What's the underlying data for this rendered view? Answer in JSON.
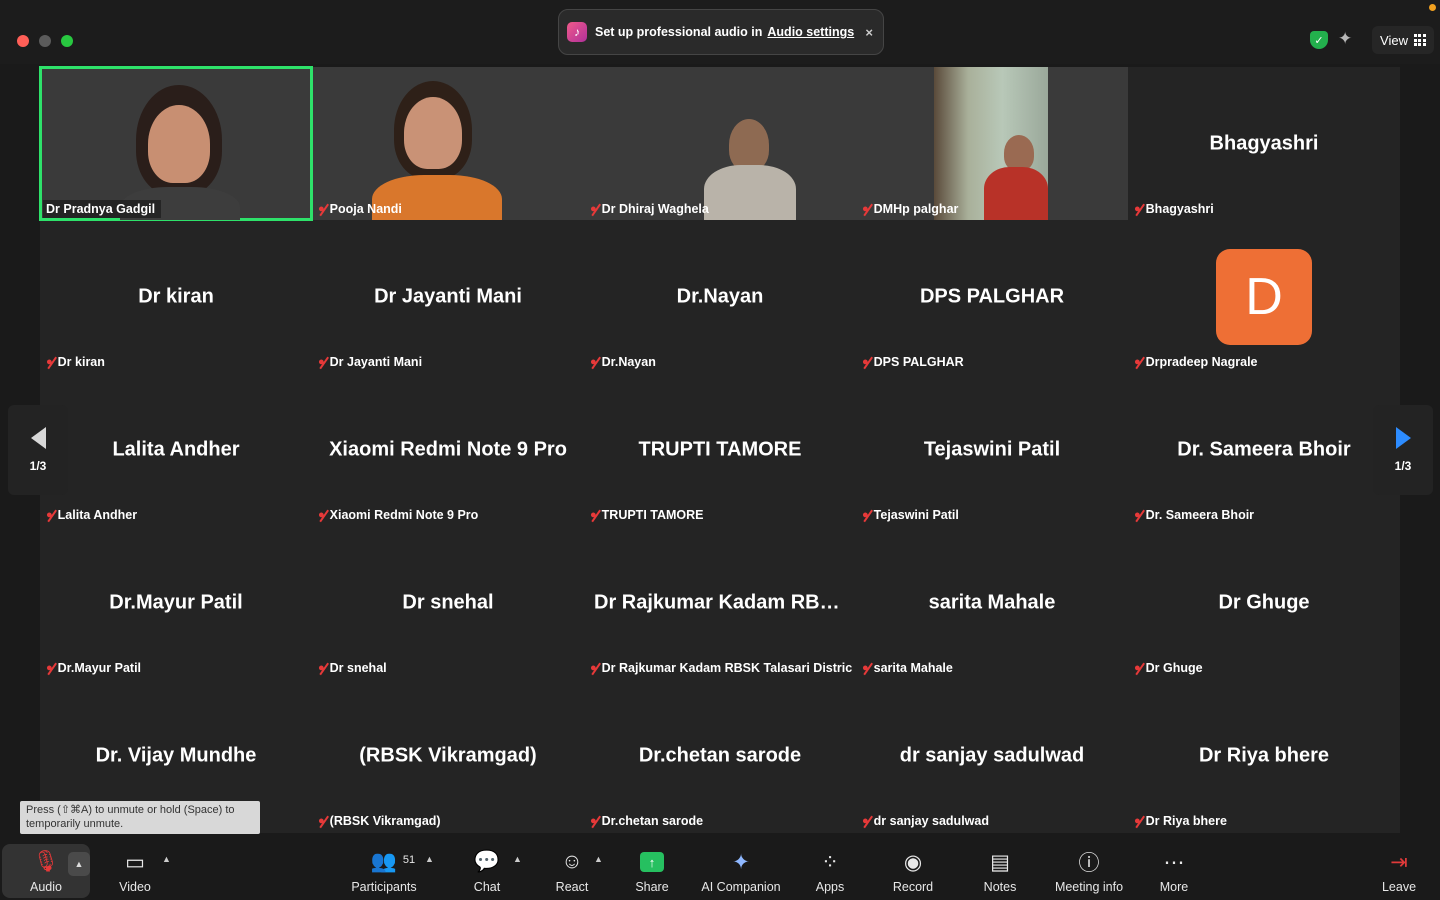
{
  "banner": {
    "text": "Set up professional audio in",
    "link": "Audio settings",
    "close": "×"
  },
  "topbar": {
    "view_label": "View"
  },
  "tiles": [
    {
      "label": "Dr Pradnya Gadgil",
      "center": ""
    },
    {
      "label": "Pooja Nandi",
      "center": ""
    },
    {
      "label": "Dr Dhiraj Waghela",
      "center": ""
    },
    {
      "label": "DMHp palghar",
      "center": ""
    },
    {
      "label": "Bhagyashri",
      "center": "Bhagyashri"
    },
    {
      "label": "Dr kiran",
      "center": "Dr kiran"
    },
    {
      "label": "Dr Jayanti Mani",
      "center": "Dr Jayanti Mani"
    },
    {
      "label": "Dr.Nayan",
      "center": "Dr.Nayan"
    },
    {
      "label": "DPS PALGHAR",
      "center": "DPS PALGHAR"
    },
    {
      "label": "Drpradeep Nagrale",
      "center": "",
      "avatar": "D"
    },
    {
      "label": "Lalita Andher",
      "center": "Lalita Andher"
    },
    {
      "label": "Xiaomi Redmi Note 9 Pro",
      "center": "Xiaomi Redmi Note 9 Pro"
    },
    {
      "label": "TRUPTI TAMORE",
      "center": "TRUPTI TAMORE"
    },
    {
      "label": "Tejaswini Patil",
      "center": "Tejaswini Patil"
    },
    {
      "label": "Dr. Sameera Bhoir",
      "center": "Dr. Sameera Bhoir"
    },
    {
      "label": "Dr.Mayur Patil",
      "center": "Dr.Mayur Patil"
    },
    {
      "label": "Dr snehal",
      "center": "Dr snehal"
    },
    {
      "label": "Dr Rajkumar Kadam RBSK Talasari Distric...",
      "center": "Dr Rajkumar Kadam RBSK..."
    },
    {
      "label": "sarita Mahale",
      "center": "sarita Mahale"
    },
    {
      "label": "Dr Ghuge",
      "center": "Dr Ghuge"
    },
    {
      "label": "",
      "center": "Dr. Vijay Mundhe"
    },
    {
      "label": "(RBSK Vikramgad)",
      "center": "(RBSK Vikramgad)"
    },
    {
      "label": "Dr.chetan sarode",
      "center": "Dr.chetan sarode"
    },
    {
      "label": "dr sanjay sadulwad",
      "center": "dr sanjay sadulwad"
    },
    {
      "label": "Dr Riya bhere",
      "center": "Dr Riya bhere"
    }
  ],
  "pagination": {
    "left": "1/3",
    "right": "1/3"
  },
  "tooltip": "Press (⇧⌘A) to unmute or hold (Space) to temporarily unmute.",
  "toolbar": {
    "audio": "Audio",
    "video": "Video",
    "participants": "Participants",
    "participants_count": "51",
    "chat": "Chat",
    "react": "React",
    "share": "Share",
    "ai_companion": "AI Companion",
    "apps": "Apps",
    "record": "Record",
    "notes": "Notes",
    "meeting_info": "Meeting info",
    "more": "More",
    "leave": "Leave"
  },
  "colors": {
    "active_speaker": "#2ee26a",
    "avatar_bg": "#ee6f35",
    "mic_muted": "#e63939",
    "share_green": "#26c060",
    "nav_arrow": "#2d8cff"
  }
}
